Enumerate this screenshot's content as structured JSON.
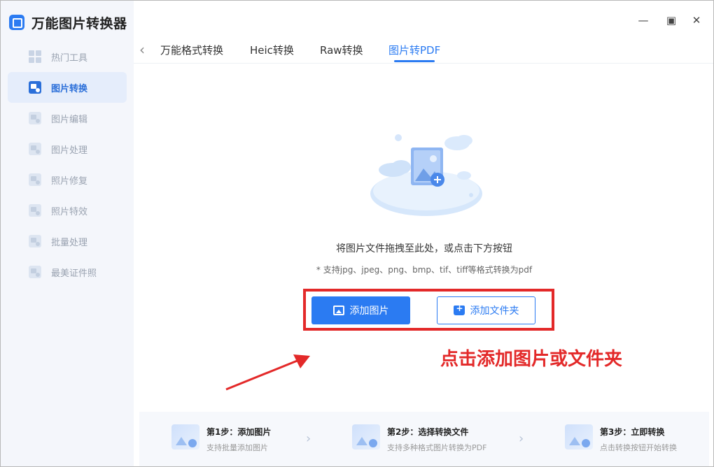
{
  "app": {
    "title": "万能图片转换器"
  },
  "sidebar": {
    "items": [
      {
        "label": "热门工具",
        "active": false,
        "icon": "grid-icon"
      },
      {
        "label": "图片转换",
        "active": true,
        "icon": "image-convert-icon"
      },
      {
        "label": "图片编辑",
        "active": false,
        "icon": "image-edit-icon"
      },
      {
        "label": "图片处理",
        "active": false,
        "icon": "image-process-icon"
      },
      {
        "label": "照片修复",
        "active": false,
        "icon": "photo-repair-icon"
      },
      {
        "label": "照片特效",
        "active": false,
        "icon": "photo-effect-icon"
      },
      {
        "label": "批量处理",
        "active": false,
        "icon": "batch-icon"
      },
      {
        "label": "最美证件照",
        "active": false,
        "icon": "id-photo-icon"
      }
    ]
  },
  "window_controls": {
    "minimize": "—",
    "maximize": "▣",
    "close": "✕"
  },
  "tabs": {
    "back": "‹",
    "items": [
      {
        "label": "万能格式转换",
        "active": false
      },
      {
        "label": "Heic转换",
        "active": false
      },
      {
        "label": "Raw转换",
        "active": false
      },
      {
        "label": "图片转PDF",
        "active": true
      }
    ]
  },
  "dropzone": {
    "main_text": "将图片文件拖拽至此处，或点击下方按钮",
    "sub_text": "* 支持jpg、jpeg、png、bmp、tif、tiff等格式转换为pdf",
    "add_image_label": "添加图片",
    "add_folder_label": "添加文件夹"
  },
  "annotation": {
    "text": "点击添加图片或文件夹",
    "color": "#e32929"
  },
  "steps": [
    {
      "title": "第1步：添加图片",
      "desc": "支持批量添加图片"
    },
    {
      "title": "第2步：选择转换文件",
      "desc": "支持多种格式图片转换为PDF"
    },
    {
      "title": "第3步：立即转换",
      "desc": "点击转换按钮开始转换"
    }
  ],
  "step_separator": "›",
  "colors": {
    "accent": "#2b7bf2",
    "annotation": "#e32929",
    "sidebar_bg": "#f4f6fb"
  }
}
